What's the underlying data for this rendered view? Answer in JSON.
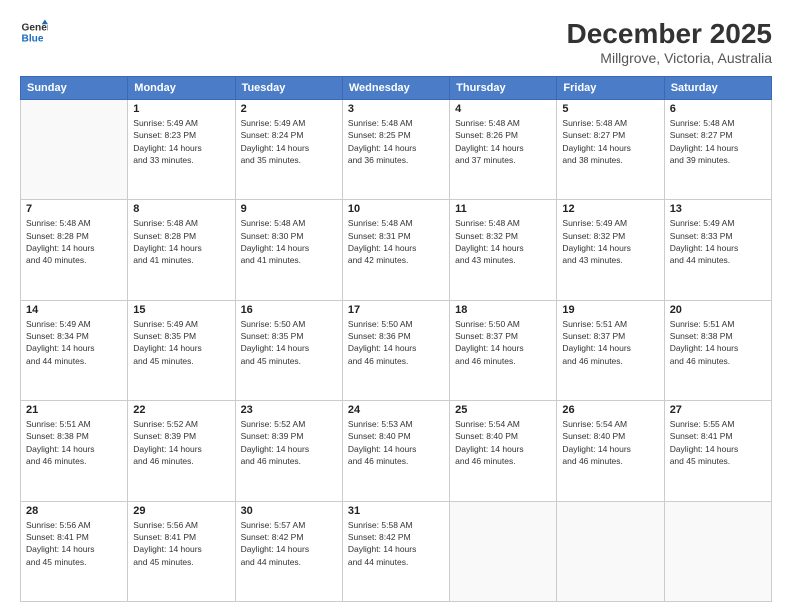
{
  "header": {
    "logo_line1": "General",
    "logo_line2": "Blue",
    "title": "December 2025",
    "subtitle": "Millgrove, Victoria, Australia"
  },
  "days_of_week": [
    "Sunday",
    "Monday",
    "Tuesday",
    "Wednesday",
    "Thursday",
    "Friday",
    "Saturday"
  ],
  "weeks": [
    [
      {
        "day": null,
        "lines": []
      },
      {
        "day": "1",
        "lines": [
          "Sunrise: 5:49 AM",
          "Sunset: 8:23 PM",
          "Daylight: 14 hours",
          "and 33 minutes."
        ]
      },
      {
        "day": "2",
        "lines": [
          "Sunrise: 5:49 AM",
          "Sunset: 8:24 PM",
          "Daylight: 14 hours",
          "and 35 minutes."
        ]
      },
      {
        "day": "3",
        "lines": [
          "Sunrise: 5:48 AM",
          "Sunset: 8:25 PM",
          "Daylight: 14 hours",
          "and 36 minutes."
        ]
      },
      {
        "day": "4",
        "lines": [
          "Sunrise: 5:48 AM",
          "Sunset: 8:26 PM",
          "Daylight: 14 hours",
          "and 37 minutes."
        ]
      },
      {
        "day": "5",
        "lines": [
          "Sunrise: 5:48 AM",
          "Sunset: 8:27 PM",
          "Daylight: 14 hours",
          "and 38 minutes."
        ]
      },
      {
        "day": "6",
        "lines": [
          "Sunrise: 5:48 AM",
          "Sunset: 8:27 PM",
          "Daylight: 14 hours",
          "and 39 minutes."
        ]
      }
    ],
    [
      {
        "day": "7",
        "lines": [
          "Sunrise: 5:48 AM",
          "Sunset: 8:28 PM",
          "Daylight: 14 hours",
          "and 40 minutes."
        ]
      },
      {
        "day": "8",
        "lines": [
          "Sunrise: 5:48 AM",
          "Sunset: 8:28 PM",
          "Daylight: 14 hours",
          "and 41 minutes."
        ]
      },
      {
        "day": "9",
        "lines": [
          "Sunrise: 5:48 AM",
          "Sunset: 8:30 PM",
          "Daylight: 14 hours",
          "and 41 minutes."
        ]
      },
      {
        "day": "10",
        "lines": [
          "Sunrise: 5:48 AM",
          "Sunset: 8:31 PM",
          "Daylight: 14 hours",
          "and 42 minutes."
        ]
      },
      {
        "day": "11",
        "lines": [
          "Sunrise: 5:48 AM",
          "Sunset: 8:32 PM",
          "Daylight: 14 hours",
          "and 43 minutes."
        ]
      },
      {
        "day": "12",
        "lines": [
          "Sunrise: 5:49 AM",
          "Sunset: 8:32 PM",
          "Daylight: 14 hours",
          "and 43 minutes."
        ]
      },
      {
        "day": "13",
        "lines": [
          "Sunrise: 5:49 AM",
          "Sunset: 8:33 PM",
          "Daylight: 14 hours",
          "and 44 minutes."
        ]
      }
    ],
    [
      {
        "day": "14",
        "lines": [
          "Sunrise: 5:49 AM",
          "Sunset: 8:34 PM",
          "Daylight: 14 hours",
          "and 44 minutes."
        ]
      },
      {
        "day": "15",
        "lines": [
          "Sunrise: 5:49 AM",
          "Sunset: 8:35 PM",
          "Daylight: 14 hours",
          "and 45 minutes."
        ]
      },
      {
        "day": "16",
        "lines": [
          "Sunrise: 5:50 AM",
          "Sunset: 8:35 PM",
          "Daylight: 14 hours",
          "and 45 minutes."
        ]
      },
      {
        "day": "17",
        "lines": [
          "Sunrise: 5:50 AM",
          "Sunset: 8:36 PM",
          "Daylight: 14 hours",
          "and 46 minutes."
        ]
      },
      {
        "day": "18",
        "lines": [
          "Sunrise: 5:50 AM",
          "Sunset: 8:37 PM",
          "Daylight: 14 hours",
          "and 46 minutes."
        ]
      },
      {
        "day": "19",
        "lines": [
          "Sunrise: 5:51 AM",
          "Sunset: 8:37 PM",
          "Daylight: 14 hours",
          "and 46 minutes."
        ]
      },
      {
        "day": "20",
        "lines": [
          "Sunrise: 5:51 AM",
          "Sunset: 8:38 PM",
          "Daylight: 14 hours",
          "and 46 minutes."
        ]
      }
    ],
    [
      {
        "day": "21",
        "lines": [
          "Sunrise: 5:51 AM",
          "Sunset: 8:38 PM",
          "Daylight: 14 hours",
          "and 46 minutes."
        ]
      },
      {
        "day": "22",
        "lines": [
          "Sunrise: 5:52 AM",
          "Sunset: 8:39 PM",
          "Daylight: 14 hours",
          "and 46 minutes."
        ]
      },
      {
        "day": "23",
        "lines": [
          "Sunrise: 5:52 AM",
          "Sunset: 8:39 PM",
          "Daylight: 14 hours",
          "and 46 minutes."
        ]
      },
      {
        "day": "24",
        "lines": [
          "Sunrise: 5:53 AM",
          "Sunset: 8:40 PM",
          "Daylight: 14 hours",
          "and 46 minutes."
        ]
      },
      {
        "day": "25",
        "lines": [
          "Sunrise: 5:54 AM",
          "Sunset: 8:40 PM",
          "Daylight: 14 hours",
          "and 46 minutes."
        ]
      },
      {
        "day": "26",
        "lines": [
          "Sunrise: 5:54 AM",
          "Sunset: 8:40 PM",
          "Daylight: 14 hours",
          "and 46 minutes."
        ]
      },
      {
        "day": "27",
        "lines": [
          "Sunrise: 5:55 AM",
          "Sunset: 8:41 PM",
          "Daylight: 14 hours",
          "and 45 minutes."
        ]
      }
    ],
    [
      {
        "day": "28",
        "lines": [
          "Sunrise: 5:56 AM",
          "Sunset: 8:41 PM",
          "Daylight: 14 hours",
          "and 45 minutes."
        ]
      },
      {
        "day": "29",
        "lines": [
          "Sunrise: 5:56 AM",
          "Sunset: 8:41 PM",
          "Daylight: 14 hours",
          "and 45 minutes."
        ]
      },
      {
        "day": "30",
        "lines": [
          "Sunrise: 5:57 AM",
          "Sunset: 8:42 PM",
          "Daylight: 14 hours",
          "and 44 minutes."
        ]
      },
      {
        "day": "31",
        "lines": [
          "Sunrise: 5:58 AM",
          "Sunset: 8:42 PM",
          "Daylight: 14 hours",
          "and 44 minutes."
        ]
      },
      {
        "day": null,
        "lines": []
      },
      {
        "day": null,
        "lines": []
      },
      {
        "day": null,
        "lines": []
      }
    ]
  ]
}
